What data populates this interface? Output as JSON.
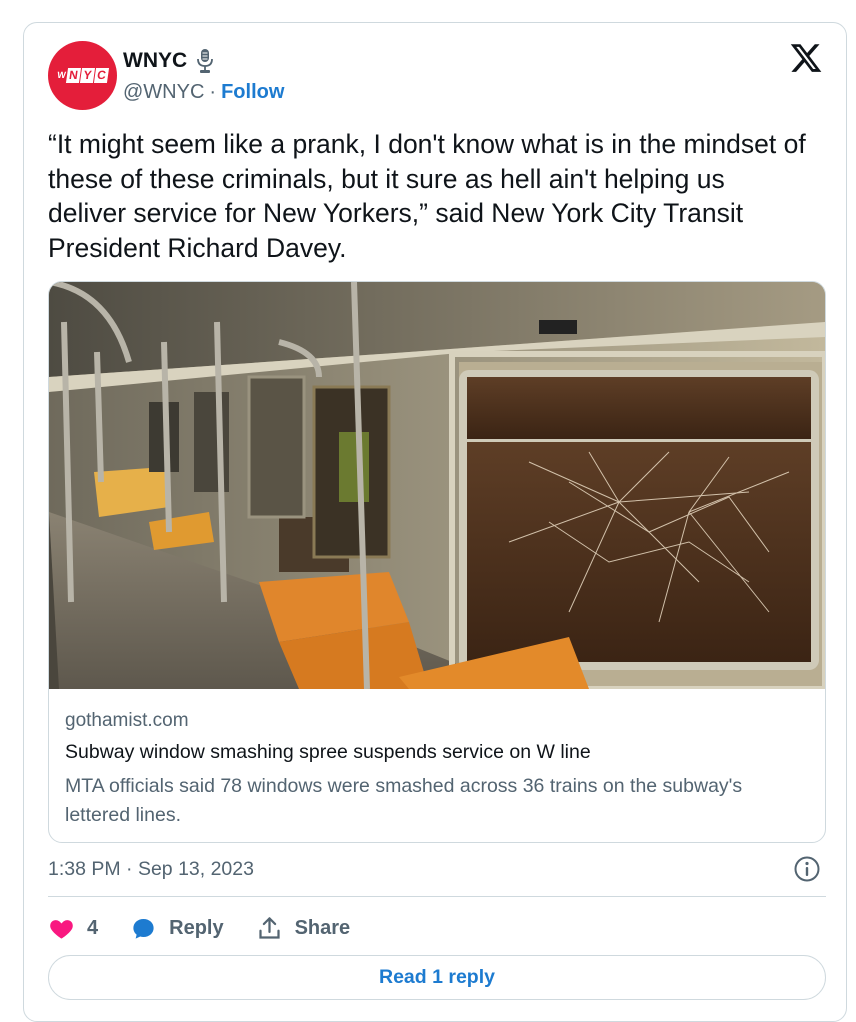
{
  "author": {
    "name": "WNYC",
    "handle": "@WNYC",
    "separator": "·",
    "follow_label": "Follow",
    "avatar_letters": [
      "W",
      "N",
      "Y",
      "C"
    ]
  },
  "tweet": {
    "text": "“It might seem like a prank, I don't know what is in the mindset of these of these criminals, but it sure as hell ain't helping us deliver service for New Yorkers,” said New York City Transit President Richard Davey."
  },
  "link_card": {
    "domain": "gothamist.com",
    "title": "Subway window smashing spree suspends service on W line",
    "description": "MTA officials said 78 windows were smashed across 36 trains on the subway's lettered lines."
  },
  "meta": {
    "timestamp": "1:38 PM · Sep 13, 2023"
  },
  "actions": {
    "like_count": "4",
    "reply_label": "Reply",
    "share_label": "Share"
  },
  "read_replies_label": "Read 1 reply",
  "colors": {
    "brand_red": "#e41e3a",
    "link_blue": "#1d7bd0",
    "like_pink": "#f91880",
    "secondary_text": "#536471",
    "border": "#cfd9de"
  },
  "icons": [
    "microphone-icon",
    "x-logo-icon",
    "info-icon",
    "heart-icon",
    "reply-bubble-icon",
    "share-icon"
  ]
}
